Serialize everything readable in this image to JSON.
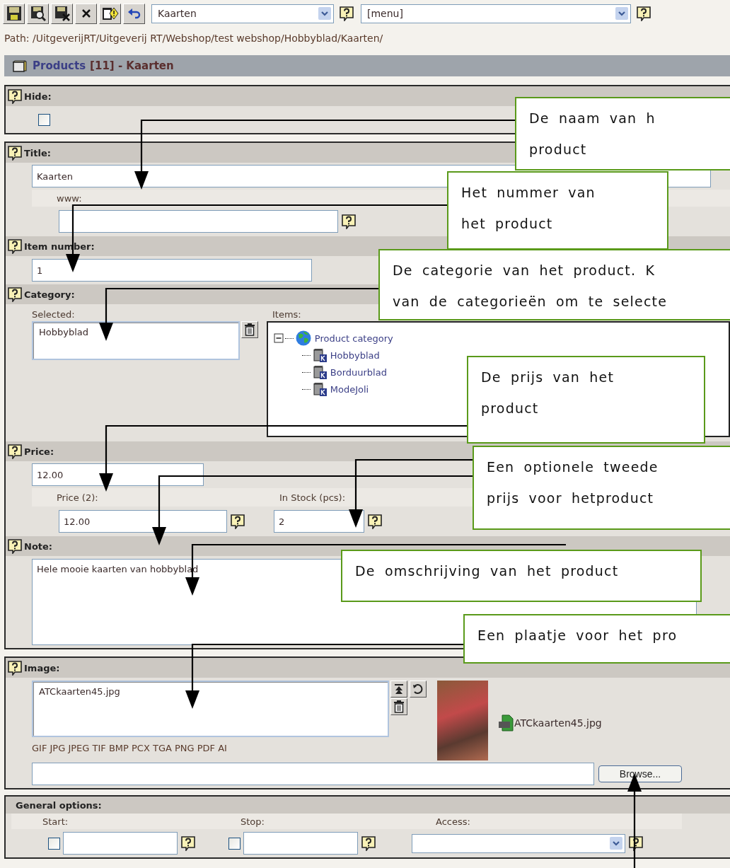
{
  "toolbar": {
    "page_select": "Kaarten",
    "menu_select": "[menu]"
  },
  "path": "Path: /UitgeverijRT/Uitgeverij RT/Webshop/test webshop/Hobbyblad/Kaarten/",
  "header": {
    "title": "Products",
    "subtitle": "[11] - Kaarten"
  },
  "hide": {
    "label": "Hide:",
    "checked": false
  },
  "title": {
    "label": "Title:",
    "value": "Kaarten",
    "www_label": "www:"
  },
  "item_number": {
    "label": "Item number:",
    "value": "1"
  },
  "category": {
    "label": "Category:",
    "selected_label": "Selected:",
    "selected": [
      "Hobbyblad"
    ],
    "items_label": "Items:",
    "tree": {
      "label": "Product category",
      "expanded": true,
      "children": [
        {
          "label": "Hobbyblad"
        },
        {
          "label": "Borduurblad"
        },
        {
          "label": "ModeJoli"
        }
      ]
    }
  },
  "price": {
    "label": "Price:",
    "value": "12.00",
    "price2_label": "Price (2):",
    "price2_value": "12.00",
    "stock_label": "In Stock (pcs):",
    "stock_value": "2"
  },
  "note": {
    "label": "Note:",
    "value": "Hele mooie kaarten van hobbyblad"
  },
  "image": {
    "label": "Image:",
    "files": [
      "ATCkaarten45.jpg"
    ],
    "formats": "GIF JPG JPEG TIF BMP PCX TGA PNG PDF AI",
    "preview_name": "ATCkaarten45.jpg",
    "browse": "Browse..."
  },
  "general_options": {
    "label": "General options:",
    "start": {
      "label": "Start:",
      "checked": false
    },
    "stop": {
      "label": "Stop:",
      "checked": false
    },
    "access_label": "Access:"
  },
  "annotations": [
    {
      "text": "De naam van h\nproduct"
    },
    {
      "text": "Het nummer van\nhet product"
    },
    {
      "text": "De categorie van het product. K\nvan de categorieën om te selecte"
    },
    {
      "text": "De prijs van het\nproduct"
    },
    {
      "text": "Een optionele tweede\nprijs voor hetproduct"
    },
    {
      "text": "De omschrijving van het product"
    },
    {
      "text": "Een plaatje voor het pro"
    }
  ]
}
